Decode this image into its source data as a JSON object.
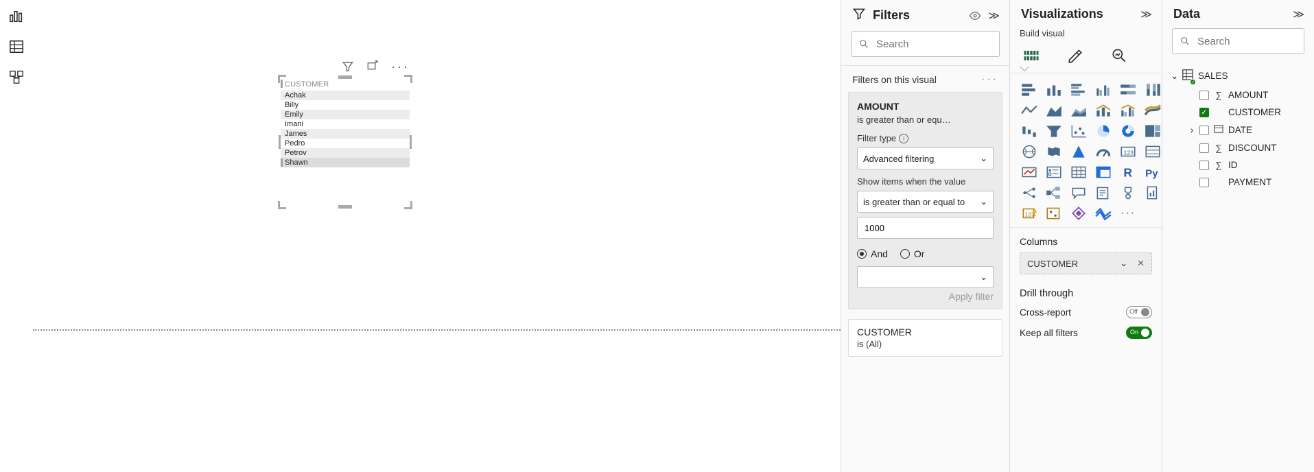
{
  "rail": {
    "items": [
      "report-view",
      "data-view",
      "model-view"
    ]
  },
  "canvas": {
    "visual": {
      "header": "CUSTOMER",
      "rows": [
        "Achak",
        "Billy",
        "Emily",
        "Imani",
        "James",
        "Pedro",
        "Petrov",
        "Shawn"
      ]
    }
  },
  "filters": {
    "title": "Filters",
    "search_placeholder": "Search",
    "section_label": "Filters on this visual",
    "card": {
      "field": "AMOUNT",
      "summary": "is greater than or equ…",
      "type_label": "Filter type",
      "type_value": "Advanced filtering",
      "show_label": "Show items when the value",
      "op_value": "is greater than or equal to",
      "value": "1000",
      "and_label": "And",
      "or_label": "Or",
      "apply_label": "Apply filter"
    },
    "card2": {
      "field": "CUSTOMER",
      "summary": "is (All)"
    }
  },
  "viz": {
    "title": "Visualizations",
    "subtitle": "Build visual",
    "columns_label": "Columns",
    "columns_value": "CUSTOMER",
    "drill_label": "Drill through",
    "cross_label": "Cross-report",
    "cross_state": "Off",
    "keep_label": "Keep all filters",
    "keep_state": "On"
  },
  "data": {
    "title": "Data",
    "search_placeholder": "Search",
    "table": "SALES",
    "fields": [
      {
        "name": "AMOUNT",
        "sigma": true,
        "checked": false
      },
      {
        "name": "CUSTOMER",
        "sigma": false,
        "checked": true
      },
      {
        "name": "DATE",
        "sigma": false,
        "checked": false,
        "expandable": true,
        "date": true
      },
      {
        "name": "DISCOUNT",
        "sigma": true,
        "checked": false
      },
      {
        "name": "ID",
        "sigma": true,
        "checked": false
      },
      {
        "name": "PAYMENT",
        "sigma": false,
        "checked": false
      }
    ]
  }
}
